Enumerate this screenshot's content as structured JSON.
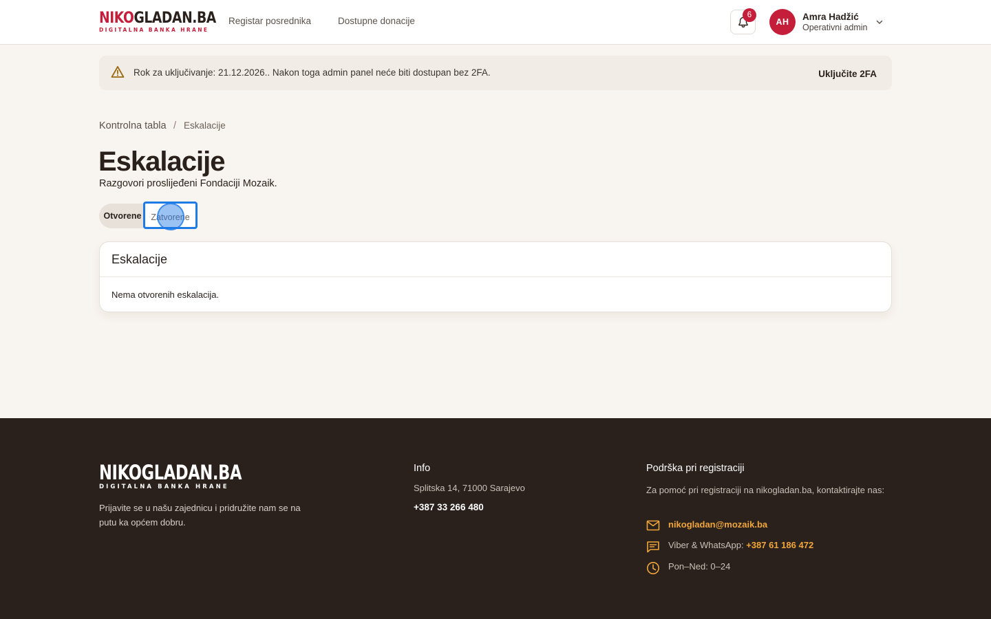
{
  "header": {
    "logo": {
      "part1": "NIKO",
      "part2": "GLADAN.BA",
      "tagline": "DIGITALNA BANKA HRANE"
    },
    "nav": [
      "Registar posrednika",
      "Dostupne donacije"
    ],
    "notifications_count": "6",
    "user": {
      "initials": "AH",
      "name": "Amra Hadžić",
      "role": "Operativni admin"
    }
  },
  "banner": {
    "text": "Rok za uključivanje: 21.12.2026.. Nakon toga admin panel neće biti dostupan bez 2FA.",
    "action": "Uključite 2FA"
  },
  "breadcrumb": {
    "home": "Kontrolna tabla",
    "separator": "/",
    "current": "Eskalacije"
  },
  "page": {
    "title": "Eskalacije",
    "subtitle": "Razgovori proslijeđeni Fondaciji Mozaik.",
    "tabs": [
      "Otvorene",
      "Zatvorene"
    ]
  },
  "card": {
    "title": "Eskalacije",
    "empty": "Nema otvorenih eskalacija."
  },
  "footer": {
    "logo": {
      "main": "NIKOGLADAN.BA",
      "tagline": "DIGITALNA BANKA HRANE"
    },
    "description": "Prijavite se u našu zajednicu i pridružite nam se na putu ka općem dobru.",
    "info": {
      "heading": "Info",
      "address": "Splitska 14, 71000 Sarajevo",
      "phone": "+387 33 266 480"
    },
    "support": {
      "heading": "Podrška pri registraciji",
      "text": "Za pomoć pri registraciji na nikogladan.ba, kontaktirajte nas:",
      "email": "nikogladan@mozaik.ba",
      "viber_label": "Viber & WhatsApp:",
      "viber_number": "+387 61 186 472",
      "hours": "Pon–Ned: 0–24"
    }
  },
  "colors": {
    "brand": "#c41e3a",
    "footer_bg": "#2a211c",
    "accent": "#f0a63a",
    "focus": "#1e7be6"
  }
}
